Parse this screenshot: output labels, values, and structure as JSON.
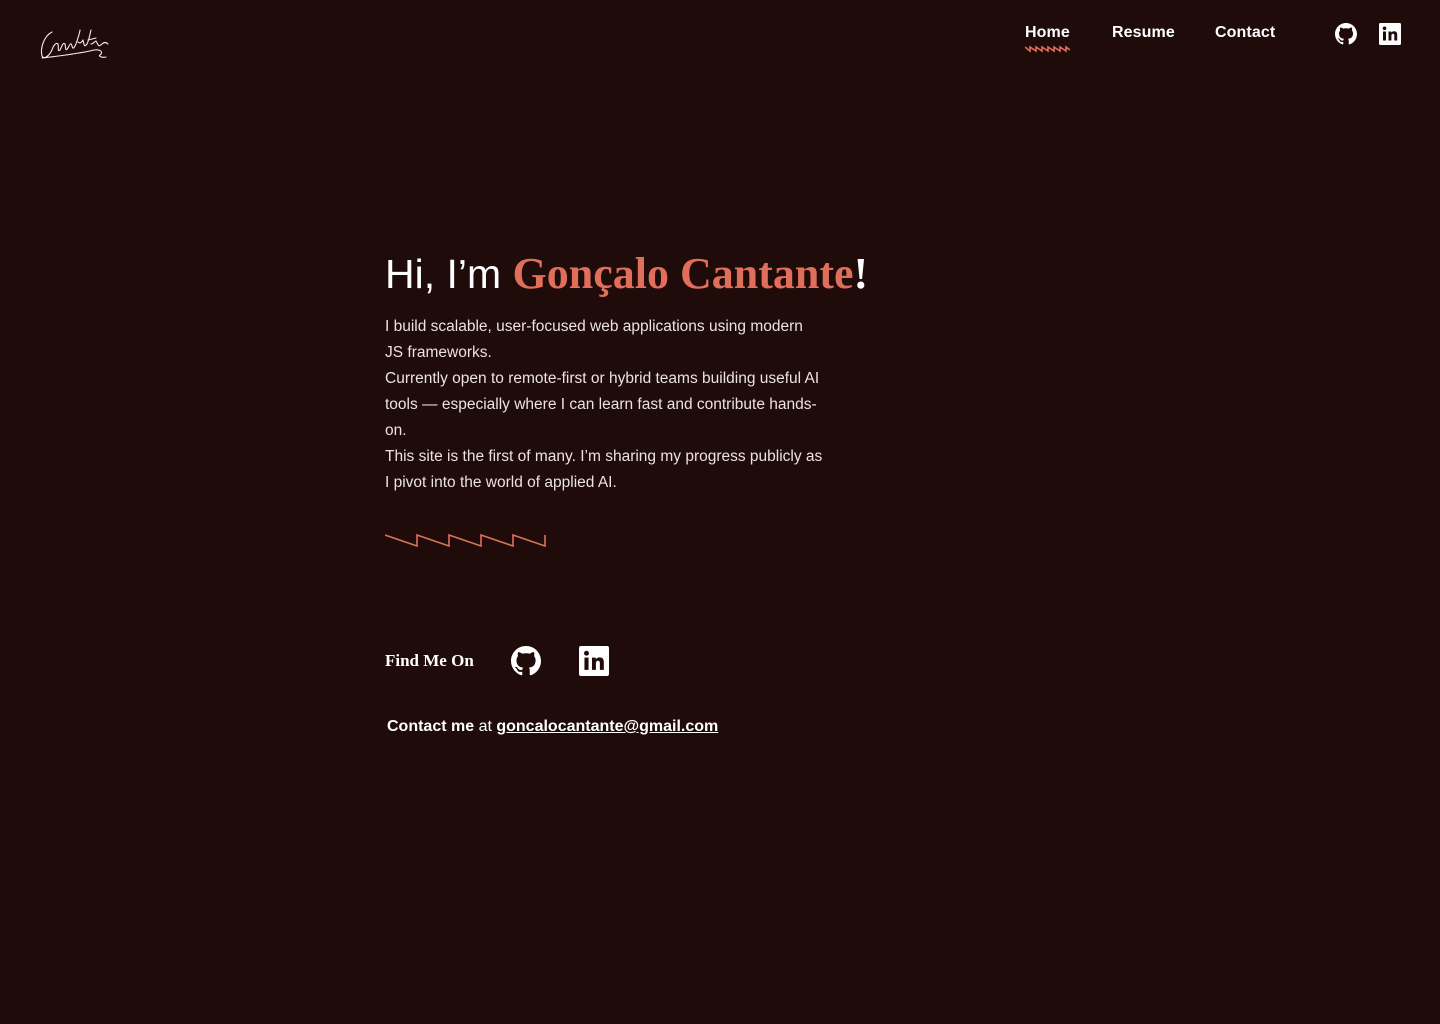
{
  "header": {
    "logo_text": "Cantante",
    "nav": [
      {
        "label": "Home",
        "active": true
      },
      {
        "label": "Resume",
        "active": false
      },
      {
        "label": "Contact",
        "active": false
      }
    ],
    "social_icons": [
      "github-icon",
      "linkedin-icon"
    ]
  },
  "hero": {
    "greeting": "Hi, I’m ",
    "name": "Gonçalo Cantante",
    "exclamation": "!",
    "bio": [
      "I build scalable, user-focused web applications using modern JS frameworks.",
      "Currently open to remote-first or hybrid teams building useful AI tools — especially where I can learn fast and contribute hands-on.",
      "This site is the first of many. I’m sharing my progress publicly as I pivot into the world of applied AI."
    ]
  },
  "find_me": {
    "label": "Find Me On",
    "icons": [
      "github-icon",
      "linkedin-icon"
    ]
  },
  "contact": {
    "prefix": "Contact me",
    "middle": " at ",
    "email": "goncalocantante@gmail.com"
  },
  "colors": {
    "background": "#1e0b0a",
    "accent": "#df6e5a",
    "text": "#ffffff"
  }
}
